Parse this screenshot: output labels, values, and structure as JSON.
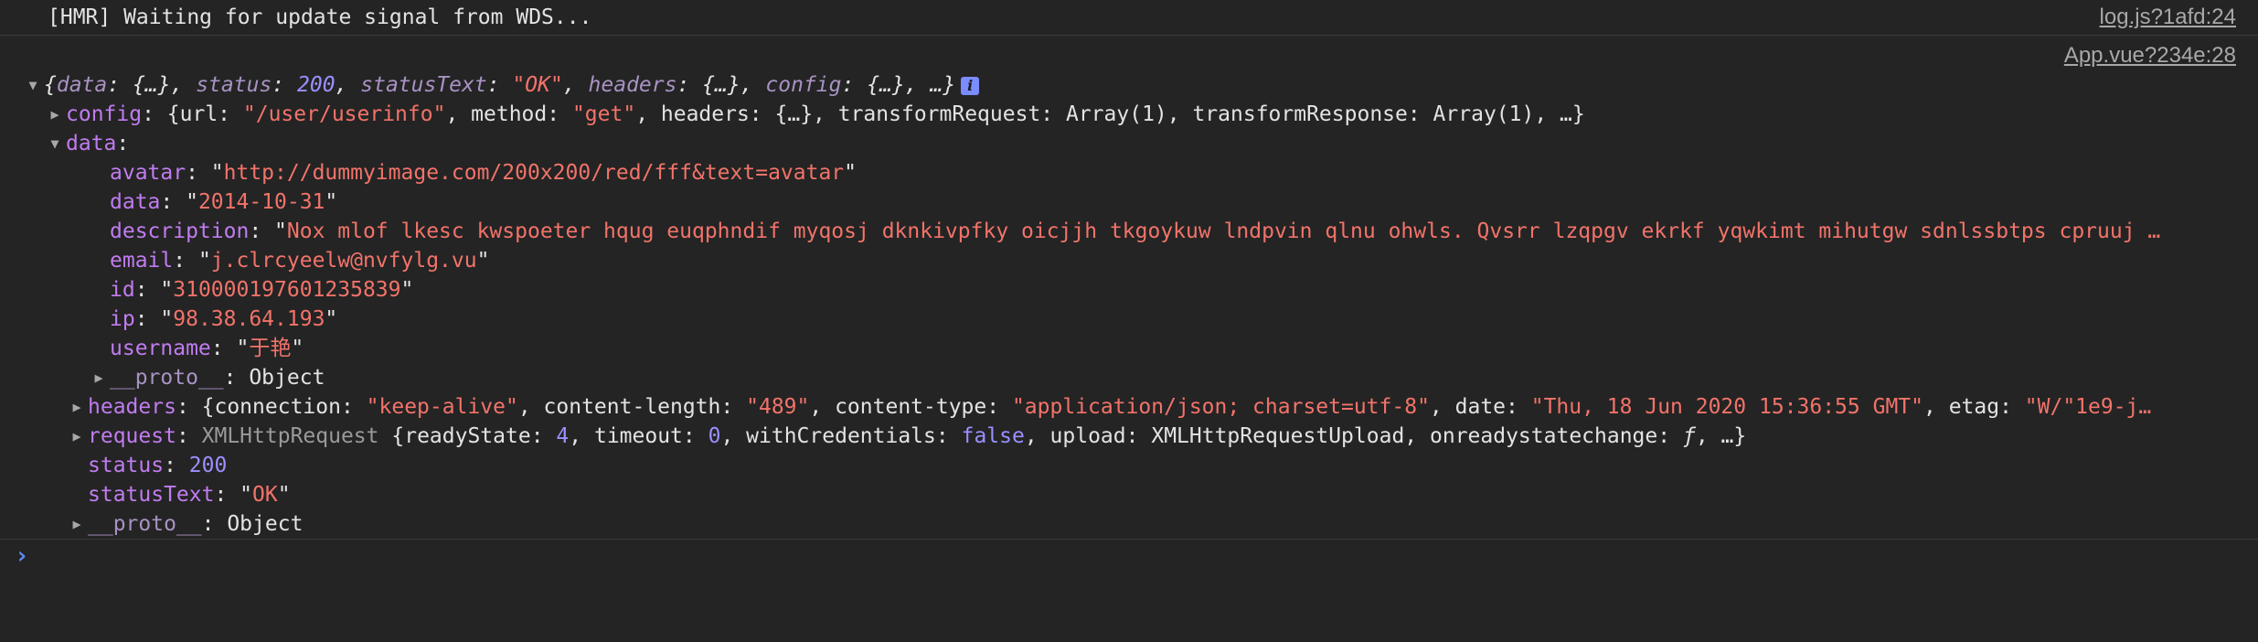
{
  "log1": {
    "text": "[HMR] Waiting for update signal from WDS...",
    "source": "log.js?1afd:24"
  },
  "log2": {
    "source": "App.vue?234e:28",
    "summary": {
      "open": "{",
      "k_data": "data",
      "v_data": "{…}",
      "k_status": "status",
      "v_status": "200",
      "k_statusText": "statusText",
      "v_statusText": "\"OK\"",
      "k_headers": "headers",
      "v_headers": "{…}",
      "k_config": "config",
      "v_config": "{…}",
      "close": "…}",
      "info": "i"
    },
    "config": {
      "key": "config",
      "p1": "{url: ",
      "url": "\"/user/userinfo\"",
      "p2": ", method: ",
      "method": "\"get\"",
      "p3": ", headers: {…}, transformRequest: Array(1), transformResponse: Array(1), …}"
    },
    "data": {
      "key": "data",
      "avatar_k": "avatar",
      "avatar_v": "http://dummyimage.com/200x200/red/fff&text=avatar",
      "date_k": "data",
      "date_v": "2014-10-31",
      "desc_k": "description",
      "desc_v": "Nox mlof lkesc kwspoeter hqug euqphndif myqosj dknkivpfky oicjjh tkgoykuw lndpvin qlnu ohwls. Qvsrr lzqpgv ekrkf yqwkimt mihutgw sdnlssbtps cpruuj …",
      "email_k": "email",
      "email_v": "j.clrcyeelw@nvfylg.vu",
      "id_k": "id",
      "id_v": "310000197601235839",
      "ip_k": "ip",
      "ip_v": "98.38.64.193",
      "username_k": "username",
      "username_v": "于艳",
      "proto_k": "__proto__",
      "proto_v": "Object"
    },
    "headers": {
      "key": "headers",
      "k1": "connection",
      "v1": "\"keep-alive\"",
      "k2": "content-length",
      "v2": "\"489\"",
      "k3": "content-type",
      "v3": "\"application/json; charset=utf-8\"",
      "k4": "date",
      "v4": "\"Thu, 18 Jun 2020 15:36:55 GMT\"",
      "k5": "etag",
      "v5": "\"W/\"1e9-j…"
    },
    "request": {
      "key": "request",
      "type": "XMLHttpRequest",
      "k1": "readyState",
      "v1": "4",
      "k2": "timeout",
      "v2": "0",
      "k3": "withCredentials",
      "v3": "false",
      "k4": "upload",
      "v4": "XMLHttpRequestUpload",
      "k5": "onreadystatechange",
      "v5": "ƒ",
      "tail": "…}"
    },
    "status": {
      "key": "status",
      "value": "200"
    },
    "statusText": {
      "key": "statusText",
      "value": "OK"
    },
    "proto": {
      "key": "__proto__",
      "value": "Object"
    }
  },
  "prompt": {
    "caret": "›",
    "value": ""
  },
  "colors": {
    "background": "#242424",
    "key": "#c07cf0",
    "string": "#f2736a",
    "number": "#9a90ff",
    "prompt": "#5c8ef7"
  }
}
